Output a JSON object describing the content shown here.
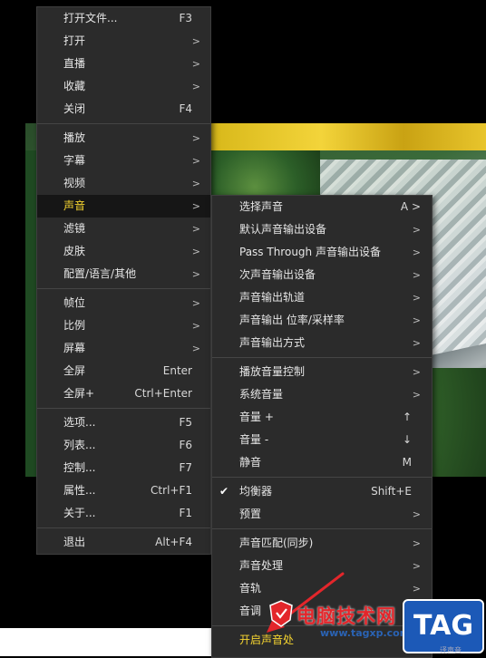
{
  "main_menu": {
    "items": [
      {
        "label": "打开文件...",
        "shortcut": "F3"
      },
      {
        "label": "打开",
        "arrow": ">"
      },
      {
        "label": "直播",
        "arrow": ">"
      },
      {
        "label": "收藏",
        "arrow": ">"
      },
      {
        "label": "关闭",
        "shortcut": "F4"
      },
      {
        "label": "播放",
        "arrow": ">"
      },
      {
        "label": "字幕",
        "arrow": ">"
      },
      {
        "label": "视频",
        "arrow": ">"
      },
      {
        "label": "声音",
        "arrow": ">"
      },
      {
        "label": "滤镜",
        "arrow": ">"
      },
      {
        "label": "皮肤",
        "arrow": ">"
      },
      {
        "label": "配置/语言/其他",
        "arrow": ">"
      },
      {
        "label": "帧位",
        "arrow": ">"
      },
      {
        "label": "比例",
        "arrow": ">"
      },
      {
        "label": "屏幕",
        "arrow": ">"
      },
      {
        "label": "全屏",
        "shortcut": "Enter"
      },
      {
        "label": "全屏+",
        "shortcut": "Ctrl+Enter"
      },
      {
        "label": "选项...",
        "shortcut": "F5"
      },
      {
        "label": "列表...",
        "shortcut": "F6"
      },
      {
        "label": "控制...",
        "shortcut": "F7"
      },
      {
        "label": "属性...",
        "shortcut": "Ctrl+F1"
      },
      {
        "label": "关于...",
        "shortcut": "F1"
      },
      {
        "label": "退出",
        "shortcut": "Alt+F4"
      }
    ]
  },
  "sound_menu": {
    "items": [
      {
        "label": "选择声音",
        "shortcut": "A >"
      },
      {
        "label": "默认声音输出设备",
        "arrow": ">"
      },
      {
        "label": "Pass Through 声音输出设备",
        "arrow": ">"
      },
      {
        "label": "次声音输出设备",
        "arrow": ">"
      },
      {
        "label": "声音输出轨道",
        "arrow": ">"
      },
      {
        "label": "声音输出 位率/采样率",
        "arrow": ">"
      },
      {
        "label": "声音输出方式",
        "arrow": ">"
      },
      {
        "label": "播放音量控制",
        "arrow": ">"
      },
      {
        "label": "系统音量",
        "arrow": ">"
      },
      {
        "label": "音量 +",
        "shortcut": "↑"
      },
      {
        "label": "音量 -",
        "shortcut": "↓"
      },
      {
        "label": "静音",
        "shortcut": "M"
      },
      {
        "label": "均衡器",
        "shortcut": "Shift+E",
        "check": "✔"
      },
      {
        "label": "预置",
        "arrow": ">"
      },
      {
        "label": "声音匹配(同步)",
        "arrow": ">"
      },
      {
        "label": "声音处理",
        "arrow": ">"
      },
      {
        "label": "音轨",
        "arrow": ">"
      },
      {
        "label": "音调",
        "arrow": ">"
      },
      {
        "label": "开启声音处",
        "arrow": ""
      }
    ]
  },
  "watermark": {
    "site_name": "电脑技术网",
    "url": "www.tagxp.com",
    "tag": "TAG",
    "corner_text": "译声音"
  },
  "colors": {
    "highlight_text": "#f5d430",
    "menu_bg": "#2b2b2b",
    "annotation": "#e3262b"
  }
}
